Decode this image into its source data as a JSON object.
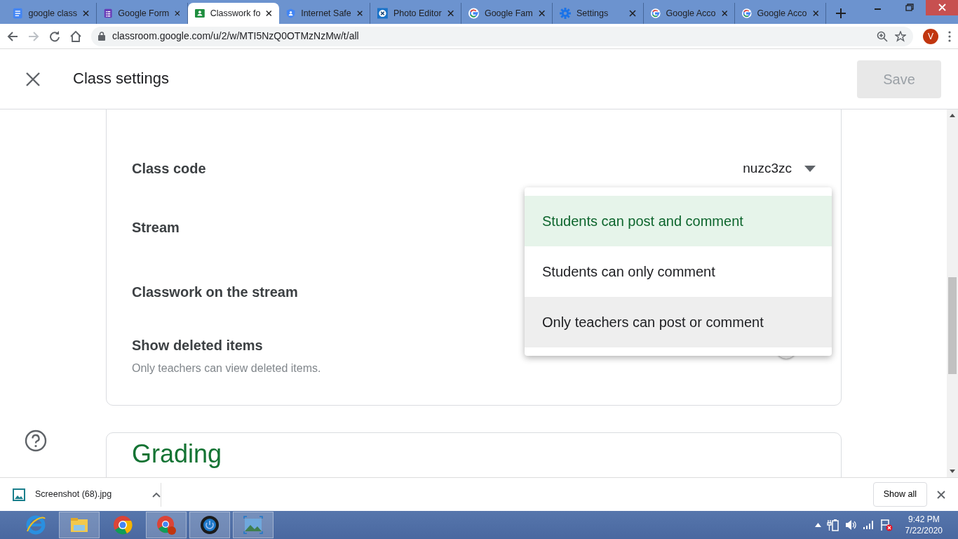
{
  "browser": {
    "tabs": [
      {
        "title": "google class",
        "kind": "docs",
        "selected": false
      },
      {
        "title": "Google Form",
        "kind": "forms",
        "selected": false
      },
      {
        "title": "Classwork fo",
        "kind": "classroom",
        "selected": true
      },
      {
        "title": "Internet Safe",
        "kind": "shield",
        "selected": false
      },
      {
        "title": "Photo Editor",
        "kind": "photo",
        "selected": false
      },
      {
        "title": "Google Fam",
        "kind": "google",
        "selected": false
      },
      {
        "title": "Settings",
        "kind": "gear",
        "selected": false
      },
      {
        "title": "Google Acco",
        "kind": "google",
        "selected": false
      },
      {
        "title": "Google Acco",
        "kind": "google",
        "selected": false
      }
    ],
    "url": "classroom.google.com/u/2/w/MTI5NzQ0OTMzNzMw/t/all",
    "profile_initial": "V"
  },
  "header": {
    "title": "Class settings",
    "save_label": "Save",
    "save_disabled": true
  },
  "settings": [
    {
      "kind": "value",
      "label": "Class code",
      "value": "nuzc3zc"
    },
    {
      "kind": "plain",
      "label": "Stream"
    },
    {
      "kind": "plain",
      "label": "Classwork on the stream"
    },
    {
      "kind": "toggle",
      "label": "Show deleted items",
      "description": "Only teachers can view deleted items.",
      "on": false
    }
  ],
  "dropdown": {
    "options": [
      {
        "label": "Students can post and comment",
        "selected": true,
        "hovered": false
      },
      {
        "label": "Students can only comment",
        "selected": false,
        "hovered": false
      },
      {
        "label": "Only teachers can post or comment",
        "selected": false,
        "hovered": true
      }
    ]
  },
  "next_section": {
    "title": "Grading"
  },
  "downloads": {
    "file": "Screenshot (68).jpg",
    "show_all": "Show all"
  },
  "taskbar": {
    "time": "9:42 PM",
    "date": "7/22/2020"
  }
}
